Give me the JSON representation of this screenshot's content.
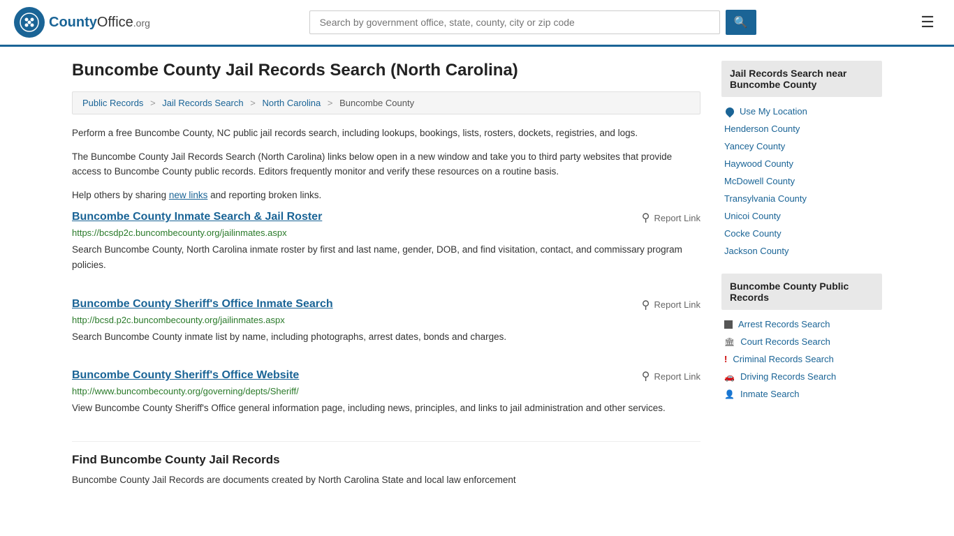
{
  "header": {
    "logo_text": "County",
    "logo_org": "Office",
    "logo_tld": ".org",
    "search_placeholder": "Search by government office, state, county, city or zip code"
  },
  "page": {
    "title": "Buncombe County Jail Records Search (North Carolina)"
  },
  "breadcrumb": {
    "items": [
      "Public Records",
      "Jail Records Search",
      "North Carolina",
      "Buncombe County"
    ]
  },
  "intro": {
    "para1": "Perform a free Buncombe County, NC public jail records search, including lookups, bookings, lists, rosters, dockets, registries, and logs.",
    "para2": "The Buncombe County Jail Records Search (North Carolina) links below open in a new window and take you to third party websites that provide access to Buncombe County public records. Editors frequently monitor and verify these resources on a routine basis.",
    "para3_pre": "Help others by sharing ",
    "para3_link": "new links",
    "para3_post": " and reporting broken links."
  },
  "results": [
    {
      "title": "Buncombe County Inmate Search & Jail Roster",
      "url": "https://bcsdp2c.buncombecounty.org/jailinmates.aspx",
      "description": "Search Buncombe County, North Carolina inmate roster by first and last name, gender, DOB, and find visitation, contact, and commissary program policies."
    },
    {
      "title": "Buncombe County Sheriff's Office Inmate Search",
      "url": "http://bcsd.p2c.buncombecounty.org/jailinmates.aspx",
      "description": "Search Buncombe County inmate list by name, including photographs, arrest dates, bonds and charges."
    },
    {
      "title": "Buncombe County Sheriff's Office Website",
      "url": "http://www.buncombecounty.org/governing/depts/Sheriff/",
      "description": "View Buncombe County Sheriff's Office general information page, including news, principles, and links to jail administration and other services."
    }
  ],
  "report_link_label": "Report Link",
  "find_section": {
    "title": "Find Buncombe County Jail Records",
    "description": "Buncombe County Jail Records are documents created by North Carolina State and local law enforcement"
  },
  "sidebar": {
    "nearby_title": "Jail Records Search near Buncombe County",
    "use_my_location": "Use My Location",
    "nearby_counties": [
      "Henderson County",
      "Yancey County",
      "Haywood County",
      "McDowell County",
      "Transylvania County",
      "Unicoi County",
      "Cocke County",
      "Jackson County"
    ],
    "public_records_title": "Buncombe County Public Records",
    "public_records": [
      {
        "label": "Arrest Records Search",
        "icon": "square"
      },
      {
        "label": "Court Records Search",
        "icon": "building"
      },
      {
        "label": "Criminal Records Search",
        "icon": "exclaim"
      },
      {
        "label": "Driving Records Search",
        "icon": "car"
      },
      {
        "label": "Inmate Search",
        "icon": "inmate"
      }
    ]
  }
}
